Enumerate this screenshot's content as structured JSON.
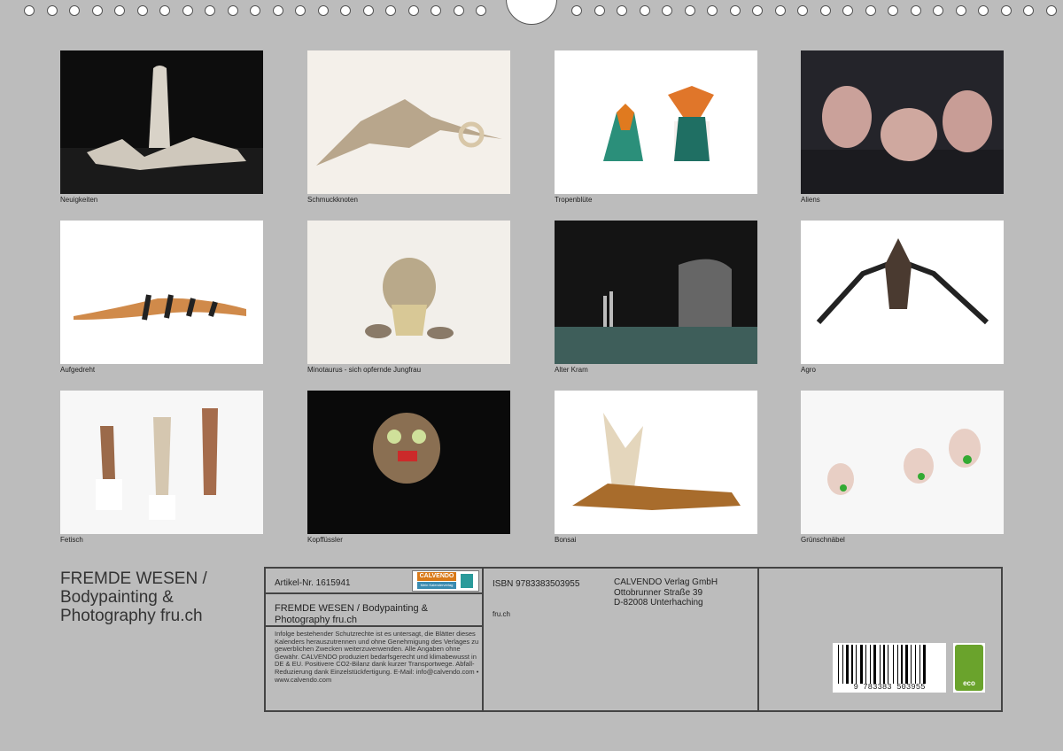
{
  "calendar": {
    "captions": [
      "Neuigkeiten",
      "Schmuckknoten",
      "Tropenblüte",
      "Aliens",
      "Aufgedreht",
      "Minotaurus - sich opfernde Jungfrau",
      "Alter Kram",
      "Agro",
      "Fetisch",
      "Kopffüssler",
      "Bonsai",
      "Grünschnäbel"
    ],
    "title_lines": [
      "FREMDE WESEN /",
      "Bodypainting &",
      "Photography fru.ch"
    ]
  },
  "imprint": {
    "article": "Artikel-Nr. 1615941",
    "logo_text": "CALVENDO",
    "logo_sub": "Mein Kalenderverlag",
    "product_title_1": "FREMDE WESEN / Bodypainting &",
    "product_title_2": "Photography fru.ch",
    "notice": "Infolge bestehender Schutzrechte ist es untersagt, die Blätter dieses Kalenders herauszutrennen und ohne Genehmigung des Verlages zu gewerblichen Zwecken weiterzuverwenden. Alle Angaben ohne Gewähr. CALVENDO produziert bedarfsgerecht und klimabewusst in DE & EU. Positivere CO2-Bilanz dank kurzer Transportwege. Abfall-Reduzierung dank Einzelstückfertigung. E-Mail: info@calvendo.com • www.calvendo.com",
    "isbn": "ISBN 9783383503955",
    "author": "fru.ch",
    "publisher": "CALVENDO Verlag GmbH",
    "street": "Ottobrunner Straße 39",
    "city": "D-82008 Unterhaching",
    "barcode_digits": "9 783383 503955",
    "eco_label": "eco"
  }
}
